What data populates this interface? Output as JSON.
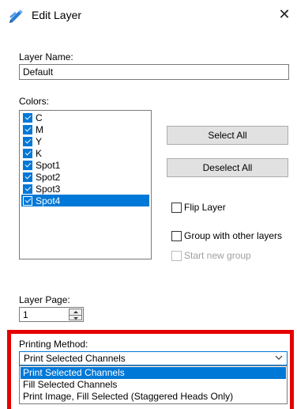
{
  "window": {
    "title": "Edit Layer",
    "title_icon": "pencil-layer-icon",
    "close_glyph": "✕"
  },
  "layer_name": {
    "label": "Layer Name:",
    "value": "Default"
  },
  "colors": {
    "label": "Colors:",
    "items": [
      {
        "label": "C",
        "checked": true,
        "selected": false
      },
      {
        "label": "M",
        "checked": true,
        "selected": false
      },
      {
        "label": "Y",
        "checked": true,
        "selected": false
      },
      {
        "label": "K",
        "checked": true,
        "selected": false
      },
      {
        "label": "Spot1",
        "checked": true,
        "selected": false
      },
      {
        "label": "Spot2",
        "checked": true,
        "selected": false
      },
      {
        "label": "Spot3",
        "checked": true,
        "selected": false
      },
      {
        "label": "Spot4",
        "checked": true,
        "selected": true
      }
    ]
  },
  "buttons": {
    "select_all": "Select All",
    "deselect_all": "Deselect All"
  },
  "options": {
    "flip_layer": "Flip Layer",
    "group_with_other": "Group with other layers",
    "start_new_group": "Start new group"
  },
  "layer_page": {
    "label": "Layer Page:",
    "value": "1"
  },
  "printing_method": {
    "label": "Printing Method:",
    "selected": "Print Selected Channels",
    "options": [
      "Print Selected Channels",
      "Fill Selected Channels",
      "Print Image, Fill Selected (Staggered Heads Only)"
    ]
  },
  "colors_theme": {
    "accent": "#0078d7",
    "highlight_frame": "#e50000"
  }
}
